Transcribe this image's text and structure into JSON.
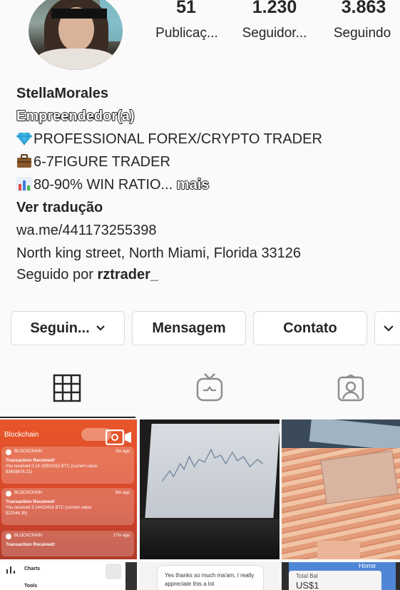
{
  "stats": [
    {
      "value": "51",
      "label": "Publicaç..."
    },
    {
      "value": "1.230",
      "label": "Seguidor..."
    },
    {
      "value": "3.863",
      "label": "Seguindo"
    }
  ],
  "profile": {
    "username": "StellaMorales",
    "category": "Empreendedor(a)",
    "bio_lines": [
      "PROFESSIONAL FOREX/CRYPTO TRADER",
      "6-7FIGURE TRADER",
      "80-90% WIN RATIO..."
    ],
    "more_label": "mais",
    "translate_label": "Ver tradução",
    "link": "wa.me/441173255398",
    "address": "North king street, North Miami, Florida 33126",
    "followed_by_prefix": "Seguido por",
    "followed_by_user": "rztrader_"
  },
  "buttons": {
    "following": "Seguin...",
    "message": "Mensagem",
    "contact": "Contato"
  },
  "tabs": [
    "grid-icon",
    "igtv-icon",
    "tagged-icon"
  ],
  "posts": {
    "tile1": {
      "app_name": "Blockchain",
      "notifications": [
        {
          "source": "BLOCKCHAIN",
          "time": "3m ago",
          "title": "Transaction Received!",
          "body1": "You received 0.16 20301052 BTC (current value:",
          "body2": "$3608676.21)"
        },
        {
          "source": "BLOCKCHAIN",
          "time": "8m ago",
          "title": "Transaction Received!",
          "body1": "You received 3.14410416 BTC (current value:",
          "body2": "$22544.35)"
        },
        {
          "source": "BLOCKCHAIN",
          "time": "17m ago",
          "title": "Transaction Received!",
          "body1": "",
          "body2": ""
        }
      ]
    },
    "tile4": {
      "label1": "Charts",
      "label2": "Tools"
    },
    "tile5": {
      "text": "Yes thanks so much ma'am, I really appreciate this a lot"
    },
    "tile6": {
      "header": "Home",
      "label": "Total Bal",
      "amount": "US$1"
    }
  },
  "colors": {
    "accent": "#262626",
    "border": "#dbdbdb",
    "blockchain_orange": "#e8572a"
  }
}
